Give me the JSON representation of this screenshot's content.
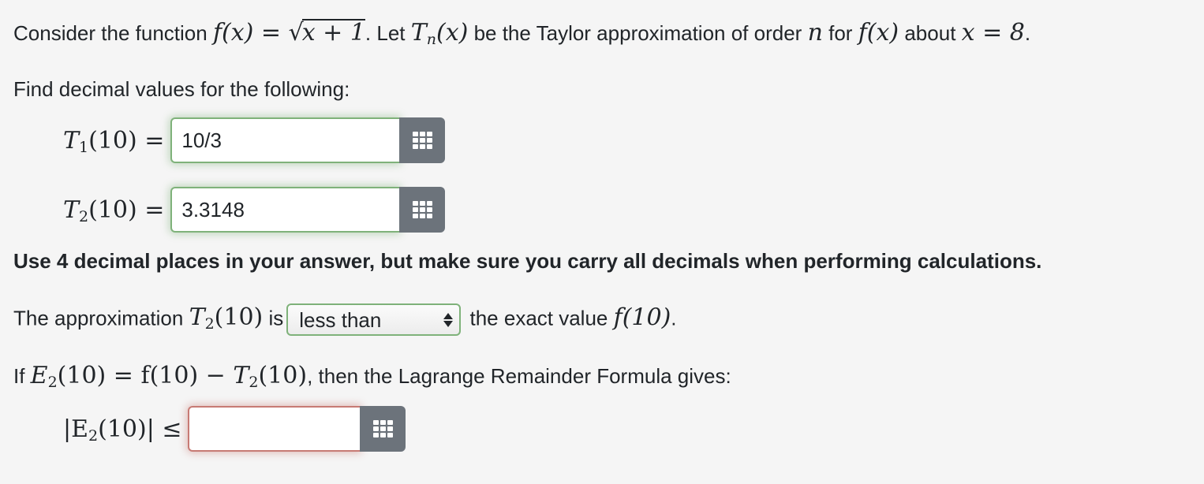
{
  "intro": {
    "text1": "Consider the function ",
    "f_of_x": "f(x) = ",
    "sqrt_arg": "x + 1",
    "text2": ". Let ",
    "Tn": "T",
    "n_sub": "n",
    "Tn_arg": "(x)",
    "text3": " be the Taylor approximation of order ",
    "n": "n",
    "text4": " for ",
    "fx": "f(x)",
    "text5": " about ",
    "about": "x = 8",
    "text6": "."
  },
  "find_text": "Find decimal values for the following:",
  "answers": [
    {
      "label_T": "T",
      "label_sub": "1",
      "label_rest": "(10) =",
      "value": "10/3",
      "status": "correct"
    },
    {
      "label_T": "T",
      "label_sub": "2",
      "label_rest": "(10) =",
      "value": "3.3148",
      "status": "correct"
    }
  ],
  "instruction": "Use 4 decimal places in your answer, but make sure you carry all decimals when performing calculations.",
  "comparison": {
    "text1": "The approximation ",
    "T": "T",
    "sub": "2",
    "arg": "(10)",
    "text2": " is",
    "selected": "less than",
    "text3": " the exact value ",
    "fval": "f(10)",
    "text4": "."
  },
  "lagrange": {
    "text1": "If ",
    "E": "E",
    "sub": "2",
    "expr1": "(10) = f(10) − ",
    "T": "T",
    "tsub": "2",
    "expr2": "(10)",
    "text2": ", then the Lagrange Remainder Formula gives:"
  },
  "bound": {
    "label_pre": "|E",
    "label_sub": "2",
    "label_rest": "(10)| ≤",
    "value": "",
    "status": "incorrect"
  },
  "icons": {
    "keyboard": "grid-keypad-icon"
  }
}
